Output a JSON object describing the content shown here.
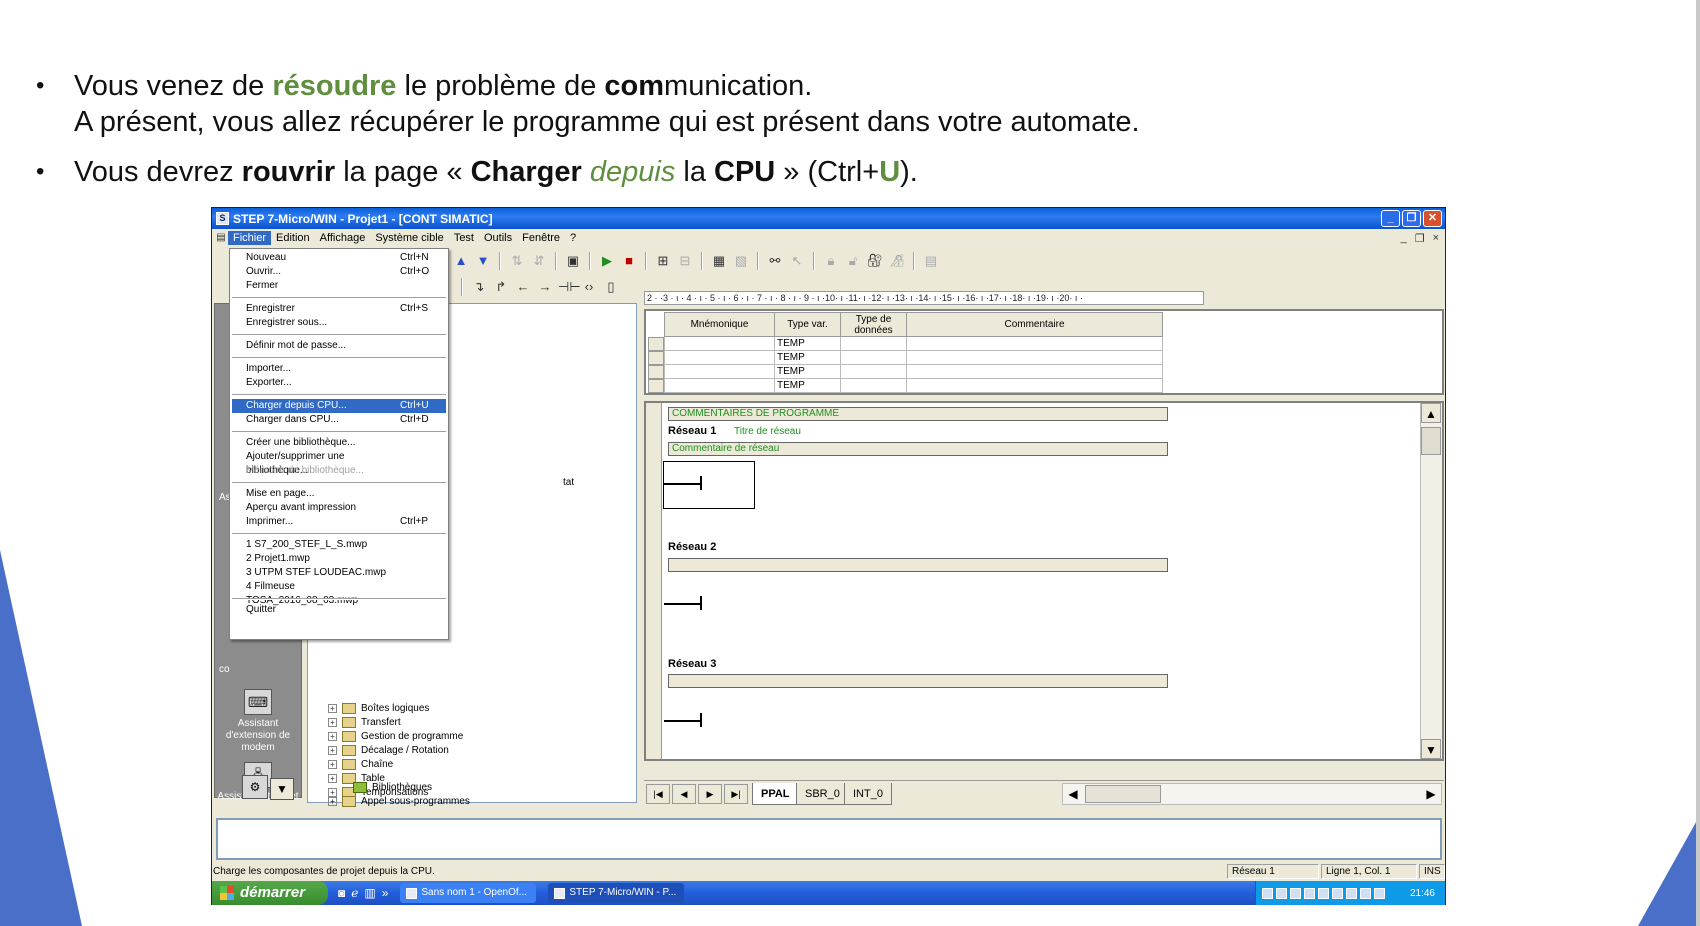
{
  "slide": {
    "bullet1_a": "Vous venez de ",
    "bullet1_b": "résoudre",
    "bullet1_c": " le problème de ",
    "bullet1_d": "com",
    "bullet1_e": "munication.",
    "bullet1_line2": "A présent, vous allez récupérer le programme qui est présent dans votre automate.",
    "bullet2_a": "Vous devrez ",
    "bullet2_b": "rouvrir",
    "bullet2_c": " la page « ",
    "bullet2_d": "Charger",
    "bullet2_e": " ",
    "bullet2_f": "depuis",
    "bullet2_g": " la ",
    "bullet2_h": "CPU",
    "bullet2_i": " » (Ctrl+",
    "bullet2_j": "U",
    "bullet2_k": ").",
    "colors": {
      "accent_green": "#5e8e3e",
      "triangle_blue": "#4a6fc8"
    }
  },
  "window": {
    "title": "STEP 7-Micro/WIN - Projet1 - [CONT SIMATIC]",
    "controls": {
      "minimize": "_",
      "restore": "❐",
      "close": "✕"
    },
    "menubar": [
      "Fichier",
      "Edition",
      "Affichage",
      "Système cible",
      "Test",
      "Outils",
      "Fenêtre",
      "?"
    ],
    "mdi_controls": [
      "_",
      "❐",
      "×"
    ]
  },
  "file_menu": {
    "items": [
      {
        "label": "Nouveau",
        "shortcut": "Ctrl+N"
      },
      {
        "label": "Ouvrir...",
        "shortcut": "Ctrl+O"
      },
      {
        "label": "Fermer",
        "shortcut": ""
      },
      {
        "label": "Enregistrer",
        "shortcut": "Ctrl+S"
      },
      {
        "label": "Enregistrer sous...",
        "shortcut": ""
      },
      {
        "label": "Définir mot de passe...",
        "shortcut": ""
      },
      {
        "label": "Importer...",
        "shortcut": ""
      },
      {
        "label": "Exporter...",
        "shortcut": ""
      },
      {
        "label": "Charger depuis CPU...",
        "shortcut": "Ctrl+U"
      },
      {
        "label": "Charger dans CPU...",
        "shortcut": "Ctrl+D"
      },
      {
        "label": "Créer une bibliothèque...",
        "shortcut": ""
      },
      {
        "label": "Ajouter/supprimer une bibliothèque...",
        "shortcut": ""
      },
      {
        "label": "Mémoire de bibliothèque...",
        "shortcut": ""
      },
      {
        "label": "Mise en page...",
        "shortcut": ""
      },
      {
        "label": "Aperçu avant impression",
        "shortcut": ""
      },
      {
        "label": "Imprimer...",
        "shortcut": "Ctrl+P"
      },
      {
        "label": "1 S7_200_STEF_L_S.mwp",
        "shortcut": ""
      },
      {
        "label": "2 Projet1.mwp",
        "shortcut": ""
      },
      {
        "label": "3 UTPM STEF LOUDEAC.mwp",
        "shortcut": ""
      },
      {
        "label": "4 Filmeuse TOSA_2016_08_03.mwp",
        "shortcut": ""
      },
      {
        "label": "Quitter",
        "shortcut": ""
      }
    ]
  },
  "navbar": {
    "partial_left_1": "As",
    "partial_left_2": "co",
    "item_modem": "Assistant d'extension de modem",
    "item_ethernet": "Assistant Ethernet"
  },
  "tree": {
    "stub": "tat",
    "nodes": [
      "Boîtes logiques",
      "Transfert",
      "Gestion de programme",
      "Décalage / Rotation",
      "Chaîne",
      "Table",
      "Temporisations",
      "Bibliothèques",
      "Appel sous-programmes"
    ]
  },
  "editor": {
    "ruler": "2 · ·3 · ı · 4 · ı · 5 · ı · 6 · ı · 7 · ı · 8 · ı · 9 · ı ·10· ı ·11· ı ·12· ı ·13· ı ·14· ı ·15· ı ·16· ı ·17· ı ·18· ı ·19· ı ·20· ı ·",
    "var_headers": [
      "Mnémonique",
      "Type var.",
      "Type de données",
      "Commentaire"
    ],
    "var_rows": [
      "TEMP",
      "TEMP",
      "TEMP",
      "TEMP"
    ],
    "program_comment": "COMMENTAIRES DE PROGRAMME",
    "network1": "Réseau 1",
    "network1_title": "Titre de réseau",
    "network1_comment": "Commentaire de réseau",
    "network2": "Réseau 2",
    "network3": "Réseau 3",
    "tabs": [
      "PPAL",
      "SBR_0",
      "INT_0"
    ]
  },
  "statusbar": {
    "text": "Charge les composantes de projet depuis la CPU.",
    "network": "Réseau 1",
    "position": "Ligne 1, Col. 1",
    "mode": "INS"
  },
  "taskbar": {
    "start": "démarrer",
    "tasks": [
      "Sans nom 1 - OpenOf...",
      "STEP 7-Micro/WIN - P..."
    ],
    "clock": "21:46"
  }
}
